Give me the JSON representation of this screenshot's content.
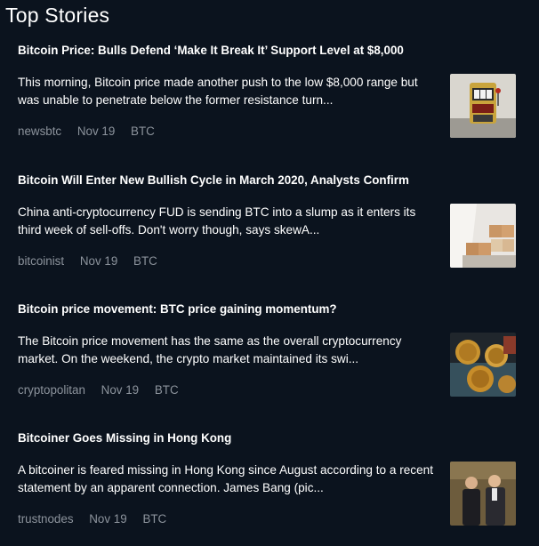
{
  "section": {
    "title": "Top Stories"
  },
  "stories": [
    {
      "title": "Bitcoin Price: Bulls Defend ‘Make It Break It’ Support Level at $8,000",
      "excerpt": "This morning, Bitcoin price made another push to the low $8,000 range but was unable to penetrate below the former resistance turn...",
      "source": "newsbtc",
      "date": "Nov 19",
      "ticker": "BTC",
      "thumbnail": "slot-machine-image"
    },
    {
      "title": "Bitcoin Will Enter New Bullish Cycle in March 2020, Analysts Confirm",
      "excerpt": "China anti-cryptocurrency FUD is sending BTC into a slump as it enters its third week of sell-offs. Don't worry though, says skewA...",
      "source": "bitcoinist",
      "date": "Nov 19",
      "ticker": "BTC",
      "thumbnail": "year-blocks-image"
    },
    {
      "title": "Bitcoin price movement: BTC price gaining momentum?",
      "excerpt": "The Bitcoin price movement has the same as the overall cryptocurrency market. On the weekend, the crypto market maintained its swi...",
      "source": "cryptopolitan",
      "date": "Nov 19",
      "ticker": "BTC",
      "thumbnail": "bitcoin-coins-image"
    },
    {
      "title": "Bitcoiner Goes Missing in Hong Kong",
      "excerpt": "A bitcoiner is feared missing in Hong Kong since August according to a recent statement by an apparent connection. James Bang (pic...",
      "source": "trustnodes",
      "date": "Nov 19",
      "ticker": "BTC",
      "thumbnail": "people-photo-image"
    }
  ]
}
